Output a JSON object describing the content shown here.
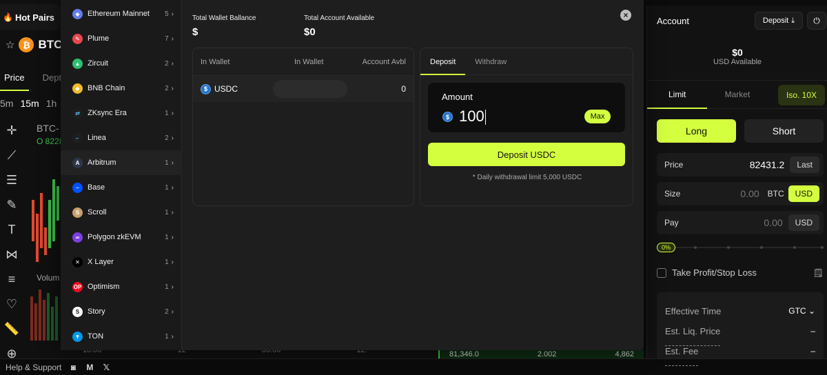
{
  "background": {
    "hot_pairs": "Hot Pairs",
    "pair": "BTC",
    "tabs": [
      "Price",
      "Dept"
    ],
    "timeframes": [
      "5m",
      "15m",
      "1h"
    ],
    "chart_title": "BTC-",
    "chart_sub": "O 8228",
    "volume_label": "Volum",
    "time_ticks": [
      "18:00",
      "12",
      "06:00",
      "12:"
    ],
    "orderbook_row": [
      "81,346.0",
      "2.002",
      "4,862"
    ]
  },
  "footer": {
    "help": "Help & Support"
  },
  "account": {
    "title": "Account",
    "deposit_label": "Deposit",
    "balance": "$0",
    "balance_sub": "USD Available",
    "order_tabs": [
      "Limit",
      "Market"
    ],
    "leverage": "Iso. 10X",
    "long": "Long",
    "short": "Short",
    "price_label": "Price",
    "price_value": "82431.2",
    "price_chip": "Last",
    "size_label": "Size",
    "size_value": "0.00",
    "size_unit_a": "BTC",
    "size_unit_b": "USD",
    "pay_label": "Pay",
    "pay_value": "0.00",
    "pay_unit": "USD",
    "slider_pct": "0%",
    "slider_fraction": 0,
    "tpsl": "Take Profit/Stop Loss",
    "eff_time_label": "Effective Time",
    "eff_time_value": "GTC",
    "liq_label": "Est. Liq. Price",
    "liq_value": "–",
    "fee_label": "Est. Fee",
    "fee_value": "–"
  },
  "chains": [
    {
      "name": "Ethereum Mainnet",
      "count": "5",
      "color": "#627eea",
      "glyph": "◆"
    },
    {
      "name": "Plume",
      "count": "7",
      "color": "#e5484d",
      "glyph": "✎"
    },
    {
      "name": "Zircuit",
      "count": "2",
      "color": "#2fbf71",
      "glyph": "▲"
    },
    {
      "name": "BNB Chain",
      "count": "2",
      "color": "#f3ba2f",
      "glyph": "◆"
    },
    {
      "name": "ZKsync Era",
      "count": "1",
      "color": "#1e1e1e",
      "glyph": "⇄"
    },
    {
      "name": "Linea",
      "count": "2",
      "color": "#1e1e1e",
      "glyph": "⌐"
    },
    {
      "name": "Arbitrum",
      "count": "1",
      "color": "#2d374b",
      "glyph": "A"
    },
    {
      "name": "Base",
      "count": "1",
      "color": "#0052ff",
      "glyph": "–"
    },
    {
      "name": "Scroll",
      "count": "1",
      "color": "#c9a06b",
      "glyph": "S"
    },
    {
      "name": "Polygon zkEVM",
      "count": "1",
      "color": "#7b3fe4",
      "glyph": "∞"
    },
    {
      "name": "X Layer",
      "count": "1",
      "color": "#000000",
      "glyph": "✕"
    },
    {
      "name": "Optimism",
      "count": "1",
      "color": "#ff0420",
      "glyph": "OP"
    },
    {
      "name": "Story",
      "count": "2",
      "color": "#ffffff",
      "glyph": "S"
    },
    {
      "name": "TON",
      "count": "1",
      "color": "#0098ea",
      "glyph": "▼"
    }
  ],
  "modal": {
    "close": "×",
    "total_wallet_label": "Total Wallet Ballance",
    "total_wallet_value": "$",
    "total_account_label": "Total Account Available",
    "total_account_value": "$0",
    "wallet_headers": [
      "In Wallet",
      "In Wallet",
      "Account Avbl"
    ],
    "wallet_row": {
      "symbol": "USDC",
      "account_avbl": "0"
    },
    "tabs": [
      "Deposit",
      "Withdraw"
    ],
    "amount_label": "Amount",
    "amount_value": "100",
    "max_label": "Max",
    "deposit_button": "Deposit USDC",
    "limit_note": "* Daily withdrawal limit 5,000 USDC"
  }
}
